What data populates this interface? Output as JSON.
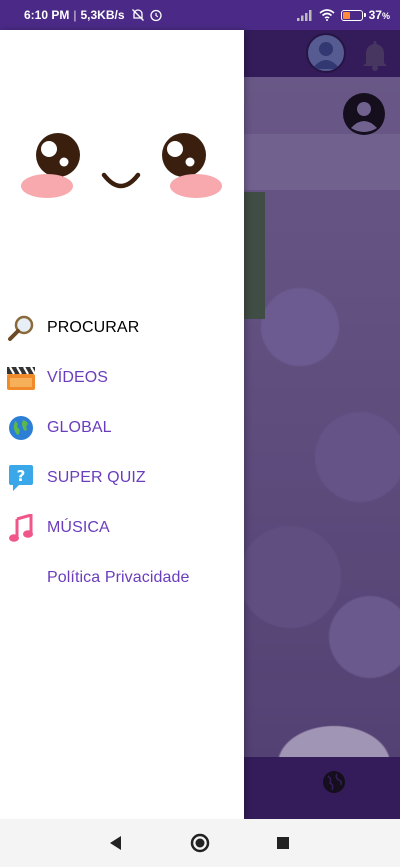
{
  "status_bar": {
    "time": "6:10 PM",
    "separator": "|",
    "net_speed": "5,3KB/s",
    "battery_percent": "37",
    "battery_suffix": "%",
    "battery_level": 0.37,
    "icons": [
      "mute-bell-icon",
      "alarm-icon",
      "signal-icon",
      "wifi-icon",
      "battery-icon"
    ]
  },
  "drawer": {
    "items": [
      {
        "label": "PROCURAR",
        "icon": "magnifier-icon"
      },
      {
        "label": "VÍDEOS",
        "icon": "clapperboard-icon"
      },
      {
        "label": "GLOBAL",
        "icon": "globe-icon"
      },
      {
        "label": "SUPER QUIZ",
        "icon": "question-icon"
      },
      {
        "label": "MÚSICA",
        "icon": "music-note-icon"
      },
      {
        "label": "Política Privacidade",
        "icon": ""
      }
    ]
  },
  "colors": {
    "status_bar": "#4a2a86",
    "menu_text": "#6a3dbd",
    "app_bar": "#3d2466"
  },
  "nav_bar": {
    "buttons": [
      "back-icon",
      "home-icon",
      "recents-icon"
    ]
  }
}
